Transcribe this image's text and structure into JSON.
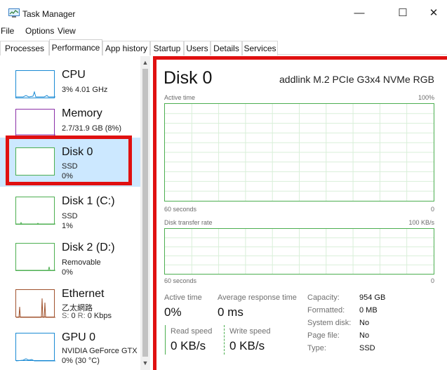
{
  "window": {
    "title": "Task Manager",
    "minimize": "—",
    "maximize": "☐",
    "close": "✕"
  },
  "menu": [
    "File",
    "Options",
    "View"
  ],
  "tabs": [
    "Processes",
    "Performance",
    "App history",
    "Startup",
    "Users",
    "Details",
    "Services"
  ],
  "active_tab": "Performance",
  "sidebar": {
    "items": [
      {
        "name": "CPU",
        "sub1": "3% 4.01 GHz",
        "sub2": "",
        "color": "#1a8ad4"
      },
      {
        "name": "Memory",
        "sub1": "2.7/31.9 GB (8%)",
        "sub2": "",
        "color": "#8b2fa8"
      },
      {
        "name": "Disk 0",
        "sub1": "SSD",
        "sub2": "0%",
        "color": "#4caf50"
      },
      {
        "name": "Disk 1 (C:)",
        "sub1": "SSD",
        "sub2": "1%",
        "color": "#4caf50"
      },
      {
        "name": "Disk 2 (D:)",
        "sub1": "Removable",
        "sub2": "0%",
        "color": "#4caf50"
      },
      {
        "name": "Ethernet",
        "sub1": "乙太網路",
        "sub2_prefix_s": "S:",
        "sub2_s": "0",
        "sub2_prefix_r": "R:",
        "sub2_r": "0 Kbps",
        "color": "#a0522d"
      },
      {
        "name": "GPU 0",
        "sub1": "NVIDIA GeForce GTX",
        "sub2": "0% (30 °C)",
        "color": "#1a8ad4"
      }
    ]
  },
  "main": {
    "title": "Disk 0",
    "model": "addlink M.2 PCIe G3x4 NVMe RGB",
    "active_time_label": "Active time",
    "active_time_max": "100%",
    "graph1_time": "60 seconds",
    "graph1_min": "0",
    "transfer_label": "Disk transfer rate",
    "transfer_max": "100 KB/s",
    "graph2_time": "60 seconds",
    "graph2_min": "0",
    "stats": {
      "active_time_label": "Active time",
      "active_time_value": "0%",
      "avg_response_label": "Average response time",
      "avg_response_value": "0 ms",
      "read_label": "Read speed",
      "read_value": "0 KB/s",
      "write_label": "Write speed",
      "write_value": "0 KB/s"
    },
    "details": {
      "capacity_key": "Capacity:",
      "capacity_val": "954 GB",
      "formatted_key": "Formatted:",
      "formatted_val": "0 MB",
      "system_key": "System disk:",
      "system_val": "No",
      "page_key": "Page file:",
      "page_val": "No",
      "type_key": "Type:",
      "type_val": "SSD"
    }
  },
  "colors": {
    "accent_green": "#4caf50",
    "highlight_red": "#e01010",
    "selected_bg": "#cce8ff"
  }
}
